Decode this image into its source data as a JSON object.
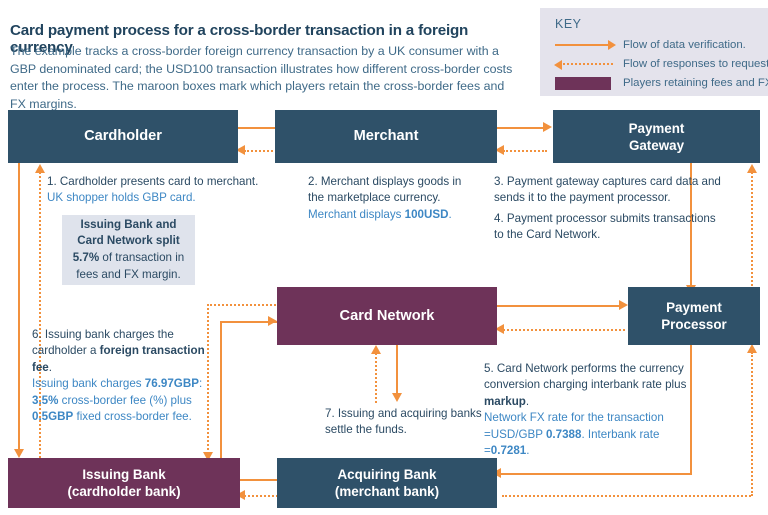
{
  "header": {
    "title": "Card payment process for a cross-border transaction in a foreign currency",
    "subtitle": "The example tracks a cross-border foreign currency transaction by a UK consumer with a GBP denominated card; the USD100 transaction illustrates how different cross-border costs enter the process. The maroon boxes mark which players retain the cross-border fees and FX margins."
  },
  "key": {
    "title": "KEY",
    "items": [
      {
        "glyph": "solid-arrow-right-icon",
        "label": "Flow of data verification."
      },
      {
        "glyph": "dotted-arrow-left-icon",
        "label": "Flow of responses to requests."
      },
      {
        "glyph": "maroon-swatch-icon",
        "label": "Players retaining fees and FX margin."
      }
    ]
  },
  "colors": {
    "navy": "#2f5169",
    "maroon": "#6e3359",
    "orange": "#f2913d",
    "blue_text": "#3d87c4",
    "key_bg": "#e4e3ec",
    "callout_bg": "#dfe3ec"
  },
  "nodes": {
    "cardholder": {
      "label": "Cardholder",
      "type": "navy"
    },
    "merchant": {
      "label": "Merchant",
      "type": "navy"
    },
    "payment_gateway": {
      "line1": "Payment",
      "line2": "Gateway",
      "type": "navy"
    },
    "card_network": {
      "label": "Card Network",
      "type": "maroon"
    },
    "payment_processor": {
      "line1": "Payment",
      "line2": "Processor",
      "type": "navy"
    },
    "issuing_bank": {
      "line1": "Issuing Bank",
      "line2": "(cardholder bank)",
      "type": "maroon"
    },
    "acquiring_bank": {
      "line1": "Acquiring Bank",
      "line2": "(merchant bank)",
      "type": "navy"
    }
  },
  "steps": {
    "s1": {
      "main": "1. Cardholder presents card to merchant.",
      "note": "UK shopper holds GBP card."
    },
    "s2": {
      "main": "2. Merchant displays goods in the marketplace currency.",
      "note_pre": "Merchant displays ",
      "note_bold": "100USD",
      "note_post": "."
    },
    "s3": {
      "main": "3. Payment gateway captures card data and sends it to the payment processor."
    },
    "s4": {
      "main": "4. Payment processor submits transactions to the Card Network."
    },
    "s5": {
      "main_pre": "5. Card Network performs the currency conversion charging interbank rate plus ",
      "main_bold": "markup",
      "main_post": ".",
      "note_a": "Network FX rate for the transaction",
      "note_b_pre": "=USD/GBP ",
      "note_b_bold1": "0.7388",
      "note_b_mid": ". Interbank rate =",
      "note_b_bold2": "0.7281",
      "note_b_post": "."
    },
    "s6": {
      "main_pre": "6. Issuing bank charges the cardholder a ",
      "main_bold": "foreign transaction fee",
      "main_post": ".",
      "note_pre": "Issuing bank charges ",
      "note_b1": "76.97GBP",
      "note_mid1": ": ",
      "note_b2": "3.5%",
      "note_mid2": " cross-border fee (%) plus ",
      "note_b3": "0.5GBP",
      "note_post": " fixed cross-border fee."
    },
    "s7": {
      "main": "7. Issuing and acquiring banks settle the funds."
    }
  },
  "callout": {
    "bold1": "Issuing Bank and Card Network split 5.7%",
    "rest": " of transaction in fees and FX margin."
  }
}
